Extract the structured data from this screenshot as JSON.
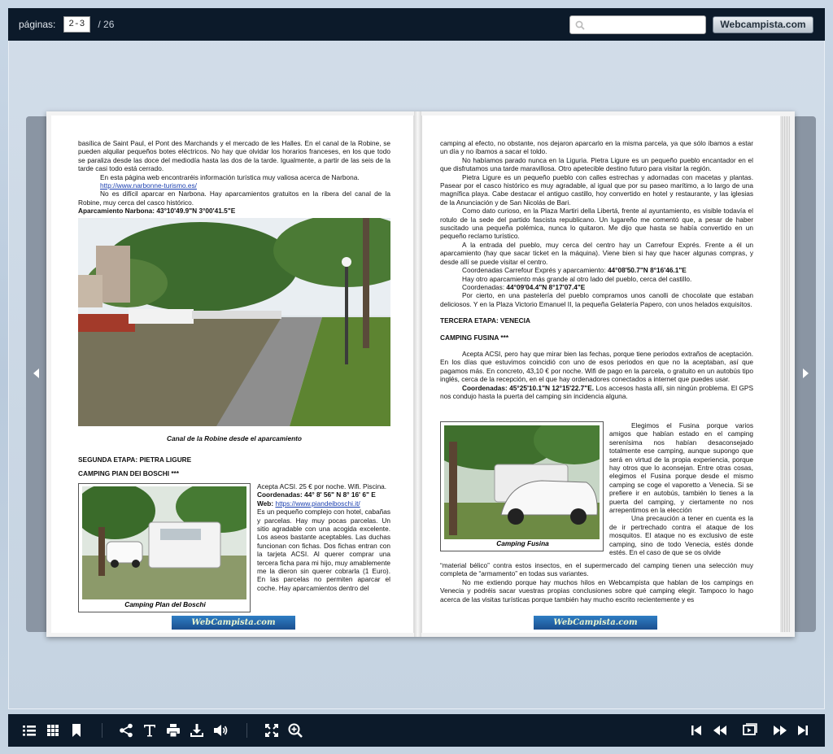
{
  "topbar": {
    "pages_label": "páginas:",
    "current_pages": "2-3",
    "total_pages": "/ 26",
    "search_placeholder": "",
    "site_button": "Webcampista.com"
  },
  "left_page": {
    "paragraphs": [
      "basílica de Saint Paul, el Pont des Marchands y el mercado de les Halles. En el canal de la Robine, se pueden alquilar pequeños botes eléctricos. No hay que olvidar los horarios franceses, en los que todo se paraliza desde las doce del mediodía hasta las dos de la tarde. Igualmente, a partir de las seis de la tarde casi todo está cerrado.",
      "En esta página web encontraréis información turística muy valiosa acerca de Narbona.",
      "http://www.narbonne-turismo.es/",
      "No es difícil aparcar en Narbona. Hay aparcamientos gratuitos en la ribera del canal de la Robine, muy cerca del casco histórico.",
      "Aparcamiento Narbona:     43°10'49.9\"N 3°00'41.5\"E"
    ],
    "photo1_caption": "Canal de la Robine desde el aparcamiento",
    "heading1": "SEGUNDA ETAPA: PIETRA LIGURE",
    "heading2": "CAMPING PIAN DEI BOSCHI ***",
    "photo2_caption": "Camping Plan del Boschi",
    "side_text_1": "Acepta ACSI. 25 € por noche. Wifi. Piscina.",
    "side_coords_label": "Coordenadas:",
    "side_coords": " 44° 8' 56\" N    8° 16' 6\" E",
    "side_web_label": "Web:",
    "side_web": "https://www.piandeiboschi.it/",
    "side_text_2": "Es un pequeño complejo con hotel, cabañas y parcelas. Hay muy pocas parcelas. Un sitio agradable con una acogida excelente. Los aseos bastante aceptables. Las duchas funcionan con fichas. Dos fichas entran con la tarjeta ACSI. Al querer comprar una tercera ficha para mi hijo, muy amablemente me la dieron sin querer cobrarla (1 Euro). En las parcelas no permiten aparcar el coche. Hay aparcamientos dentro del",
    "logo": "WebCampista.com"
  },
  "right_page": {
    "paragraphs": [
      "camping al efecto, no obstante, nos dejaron aparcarlo en la misma parcela, ya que sólo íbamos a estar un día y no íbamos a sacar el toldo.",
      "No habíamos parado nunca en la Liguria. Pietra Ligure es un pequeño pueblo encantador en el que disfrutamos una tarde maravillosa. Otro apetecible destino futuro para visitar la región.",
      "Pietra Ligure es un pequeño pueblo con calles estrechas y adornadas con macetas y plantas. Pasear por el casco histórico es muy agradable, al igual que por su paseo marítimo, a lo largo de una magnífica playa. Cabe destacar el antiguo castillo, hoy convertido en hotel y restaurante, y las iglesias de la Anunciación y de San Nicolás de Bari.",
      "Como dato curioso, en la Plaza Martiri della Libertá, frente al ayuntamiento, es visible todavía el rotulo de la sede del partido fascista republicano. Un lugareño me comentó que, a pesar de haber suscitado una pequeña polémica, nunca lo quitaron. Me dijo que hasta se había convertido en un pequeño reclamo turístico.",
      "A la entrada del pueblo, muy cerca del centro hay un Carrefour Exprés. Frente a él un aparcamiento (hay que sacar ticket en la máquina). Viene bien si hay que hacer algunas compras, y desde allí se puede visitar el centro."
    ],
    "coords_1_label": "Coordenadas Carrefour Exprés y aparcamiento:",
    "coords_1": " 44°08'50.7\"N 8°16'46.1\"E",
    "coords_text": "Hay otro aparcamiento más grande al otro lado del pueblo, cerca del castillo.",
    "coords_2_label": "Coordenadas:",
    "coords_2": " 44°09'04.4\"N 8°17'07.4\"E",
    "para_pastry": "Por cierto, en una pastelería del pueblo compramos unos canolli de chocolate que estaban deliciosos. Y en la Plaza Victorio Emanuel II, la pequeña Gelatería Papero, con unos helados exquisitos.",
    "heading1": "TERCERA ETAPA: VENECIA",
    "heading2": "CAMPING FUSINA ***",
    "para_acsi": "Acepta ACSI, pero hay que mirar bien las fechas, porque tiene periodos extraños de aceptación. En los días que estuvimos coincidió con uno de esos periodos en que no la aceptaban, así que pagamos más. En concreto, 43,10 € por noche. Wifi de pago en la parcela, o gratuito en un autobús tipo inglés, cerca de la recepción, en el que hay ordenadores conectados a internet que puedes usar.",
    "fusina_coords_label": "Coordenadas:",
    "fusina_coords": " 45°25'10.1\"N 12°15'22.7\"E.",
    "fusina_coords_text": " Los accesos hasta allí, sin ningún problema. El GPS nos condujo hasta la puerta del camping sin incidencia alguna.",
    "photo_caption": "Camping Fusina",
    "side_text_1": "Elegimos el Fusina porque varios amigos que habían estado en el camping serenísima nos habían desaconsejado totalmente ese camping, aunque supongo que será en virtud de la propia experiencia, porque hay otros que lo aconsejan. Entre otras cosas, elegimos el Fusina porque desde el mismo camping se coge el vaporetto a Venecia. Si se prefiere ir en autobús, también lo tienes a la puerta del camping, y ciertamente no nos arrepentimos en la elección",
    "side_text_2": "Una precaución a tener en cuenta es la de ir pertrechado contra el ataque de los mosquitos. El ataque no es exclusivo de este camping, sino de todo Venecia, estés donde estés. En el caso de que se os olvide",
    "para_end_1": "“material bélico” contra estos insectos, en el supermercado del camping tienen una selección muy completa de “armamento” en todas sus variantes.",
    "para_end_2": "No me extiendo porque hay muchos hilos en Webcampista que hablan de los campings en Venecia y podréis sacar vuestras propias conclusiones sobre qué camping elegir. Tampoco lo hago acerca de las visitas turísticas porque también hay mucho escrito recientemente y es",
    "logo": "WebCampista.com"
  },
  "icons": {
    "toc": "list-icon",
    "thumbs": "grid-icon",
    "bookmark": "bookmark-icon",
    "share": "share-icon",
    "text": "text-icon",
    "print": "print-icon",
    "download": "download-icon",
    "sound": "speaker-icon",
    "fullscreen": "fullscreen-icon",
    "zoom": "zoom-in-icon",
    "first": "first-page-icon",
    "prev": "previous-page-icon",
    "autoplay": "autoplay-icon",
    "next": "next-page-icon",
    "last": "last-page-icon"
  },
  "colors": {
    "bar": "#0c1a2a",
    "link": "#1a3fb0"
  }
}
